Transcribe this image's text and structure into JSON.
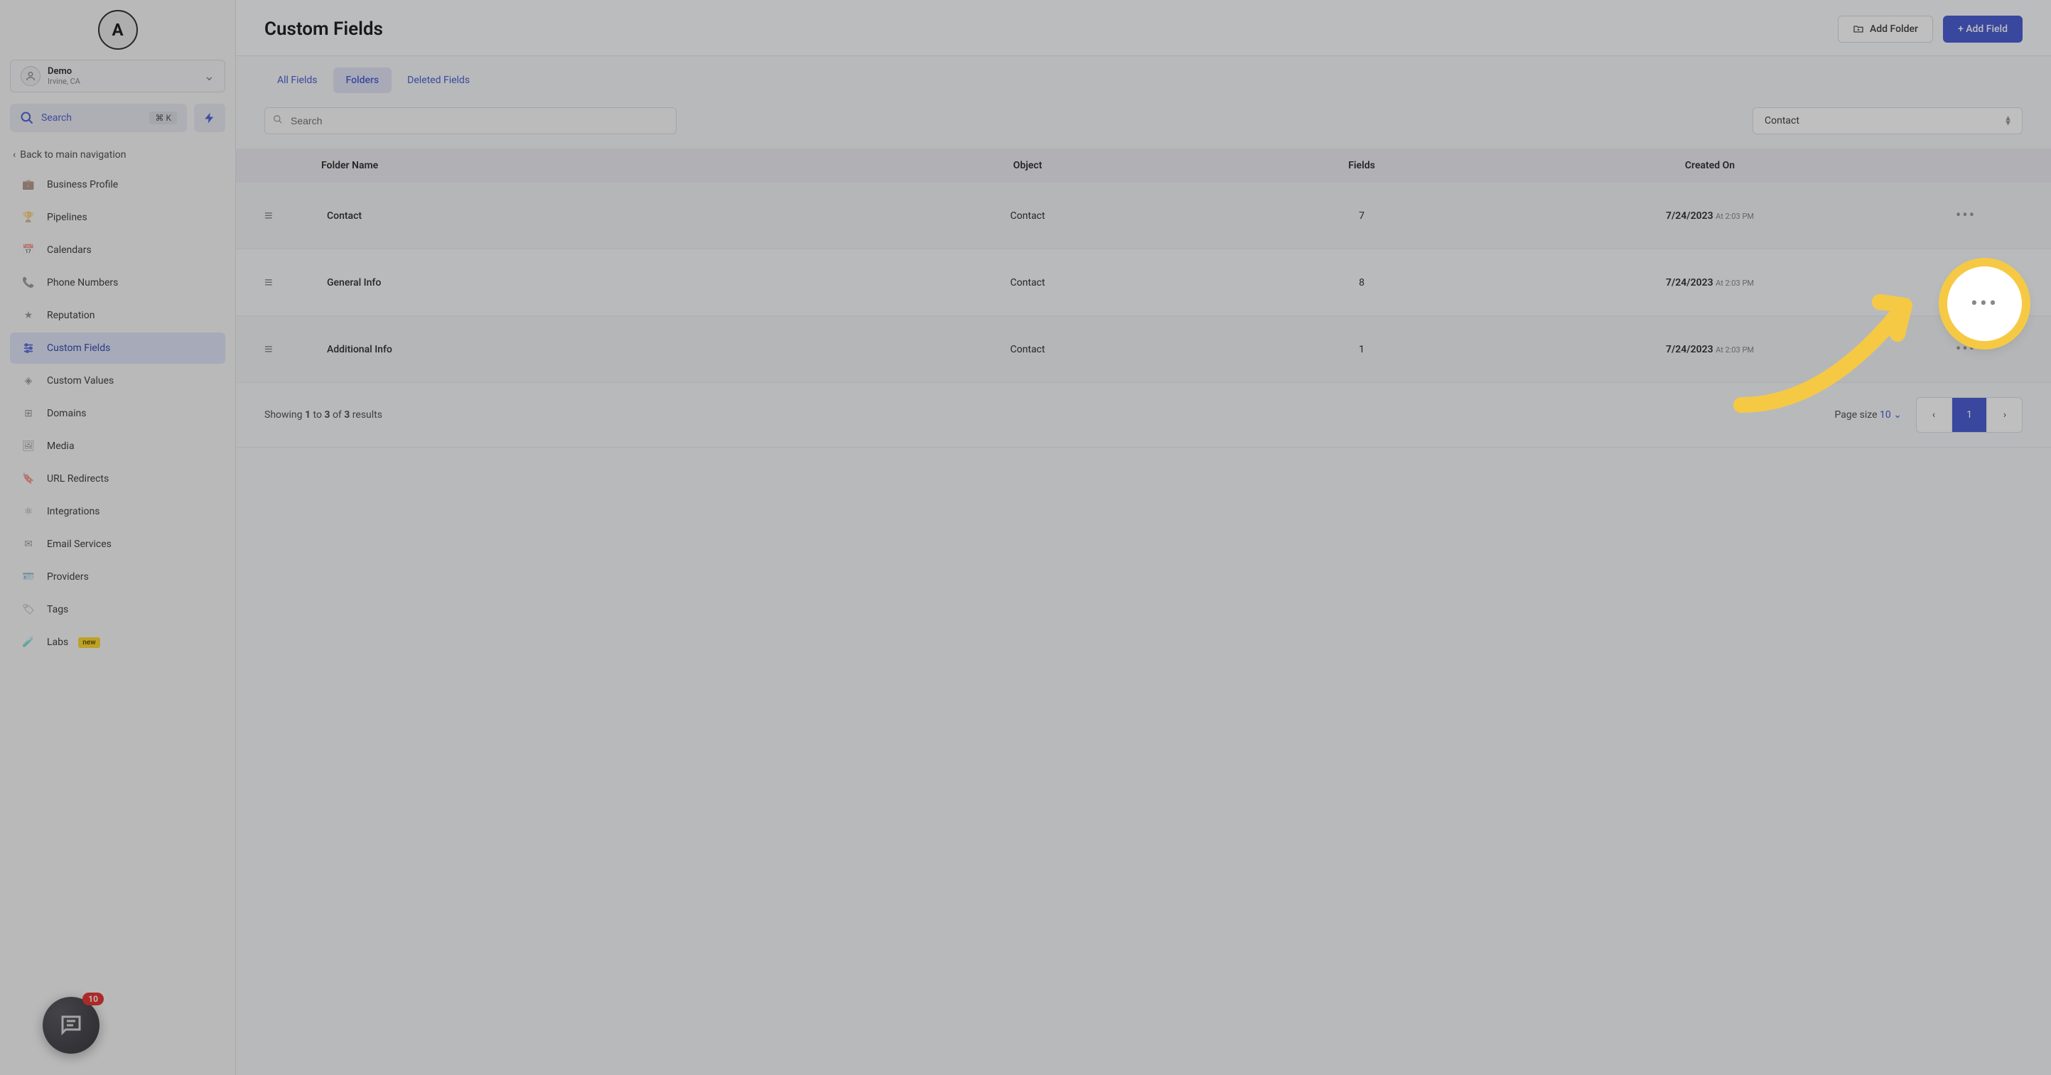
{
  "brand": {
    "letter": "A"
  },
  "account": {
    "name": "Demo",
    "location": "Irvine, CA"
  },
  "search": {
    "label": "Search",
    "kbd": "⌘ K"
  },
  "back_nav": "Back to main navigation",
  "sidebar": {
    "items": [
      {
        "label": "Business Profile",
        "icon": "briefcase"
      },
      {
        "label": "Pipelines",
        "icon": "filter"
      },
      {
        "label": "Calendars",
        "icon": "calendar"
      },
      {
        "label": "Phone Numbers",
        "icon": "phone"
      },
      {
        "label": "Reputation",
        "icon": "star"
      },
      {
        "label": "Custom Fields",
        "icon": "sliders",
        "active": true
      },
      {
        "label": "Custom Values",
        "icon": "diamond"
      },
      {
        "label": "Domains",
        "icon": "grid"
      },
      {
        "label": "Media",
        "icon": "image"
      },
      {
        "label": "URL Redirects",
        "icon": "bookmark"
      },
      {
        "label": "Integrations",
        "icon": "nodes"
      },
      {
        "label": "Email Services",
        "icon": "envelope"
      },
      {
        "label": "Providers",
        "icon": "id-card"
      },
      {
        "label": "Tags",
        "icon": "tag"
      },
      {
        "label": "Labs",
        "icon": "flask",
        "badge": "new"
      }
    ]
  },
  "chat": {
    "badge": "10"
  },
  "page": {
    "title": "Custom Fields",
    "add_folder": "Add Folder",
    "add_field": "+ Add Field"
  },
  "tabs": [
    {
      "label": "All Fields"
    },
    {
      "label": "Folders",
      "active": true
    },
    {
      "label": "Deleted Fields"
    }
  ],
  "filters": {
    "search_placeholder": "Search",
    "object_select": "Contact"
  },
  "table": {
    "columns": {
      "folder_name": "Folder Name",
      "object": "Object",
      "fields": "Fields",
      "created_on": "Created On"
    },
    "rows": [
      {
        "name": "Contact",
        "object": "Contact",
        "fields": "7",
        "date": "7/24/2023",
        "time": "At 2:03 PM"
      },
      {
        "name": "General Info",
        "object": "Contact",
        "fields": "8",
        "date": "7/24/2023",
        "time": "At 2:03 PM"
      },
      {
        "name": "Additional Info",
        "object": "Contact",
        "fields": "1",
        "date": "7/24/2023",
        "time": "At 2:03 PM"
      }
    ]
  },
  "footer": {
    "showing_prefix": "Showing ",
    "n1": "1",
    "mid1": " to ",
    "n2": "3",
    "mid2": " of ",
    "n3": "3",
    "suffix": " results",
    "page_size_label": "Page size ",
    "page_size_value": "10",
    "current_page": "1"
  }
}
